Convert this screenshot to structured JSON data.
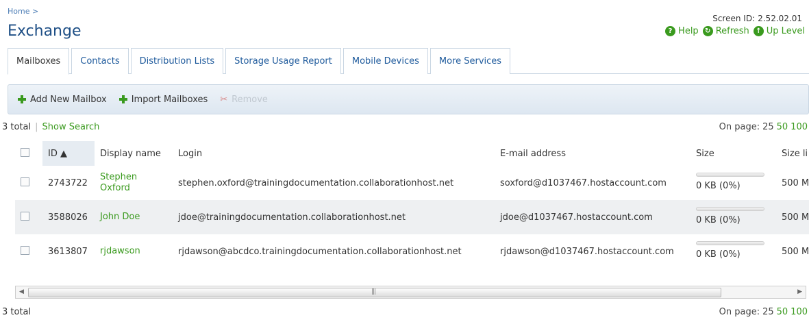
{
  "breadcrumb": "Home >",
  "title": "Exchange",
  "screen_id": {
    "label": "Screen ID:",
    "value": "2.52.02.01"
  },
  "header_links": [
    {
      "icon": "help-icon",
      "glyph": "?",
      "label": "Help"
    },
    {
      "icon": "refresh-icon",
      "glyph": "↻",
      "label": "Refresh"
    },
    {
      "icon": "up-level-icon",
      "glyph": "↑",
      "label": "Up Level"
    }
  ],
  "tabs": [
    "Mailboxes",
    "Contacts",
    "Distribution Lists",
    "Storage Usage Report",
    "Mobile Devices",
    "More Services"
  ],
  "active_tab": "Mailboxes",
  "toolbar": {
    "add_new": "Add New Mailbox",
    "import": "Import Mailboxes",
    "remove": "Remove"
  },
  "summary": {
    "total": "3 total",
    "show_search": "Show Search"
  },
  "on_page": {
    "label": "On page:",
    "options": [
      "25",
      "50",
      "100"
    ]
  },
  "table": {
    "headers": {
      "id": "ID",
      "display": "Display name",
      "login": "Login",
      "email": "E-mail address",
      "size": "Size",
      "size_limit": "Size li"
    },
    "rows": [
      {
        "id": "2743722",
        "display_line1": "Stephen",
        "display_line2": "Oxford",
        "login": "stephen.oxford@trainingdocumentation.collaborationhost.net",
        "email": "soxford@d1037467.hostaccount.com",
        "size": "0 KB (0%)",
        "size_fraction": 0,
        "limit": "500 M"
      },
      {
        "id": "3588026",
        "display_line1": "John Doe",
        "display_line2": "",
        "login": "jdoe@trainingdocumentation.collaborationhost.net",
        "email": "jdoe@d1037467.hostaccount.com",
        "size": "0 KB (0%)",
        "size_fraction": 0,
        "limit": "500 M"
      },
      {
        "id": "3613807",
        "display_line1": "rjdawson",
        "display_line2": "",
        "login": "rjdawson@abcdco.trainingdocumentation.collaborationhost.net",
        "email": "rjdawson@d1037467.hostaccount.com",
        "size": "0 KB (0%)",
        "size_fraction": 0,
        "limit": "500 M"
      }
    ]
  },
  "footer_total": "3 total",
  "colors": {
    "accent_green": "#3a9a1e",
    "title_blue": "#1e4f86",
    "tab_blue": "#1e5a9c"
  }
}
